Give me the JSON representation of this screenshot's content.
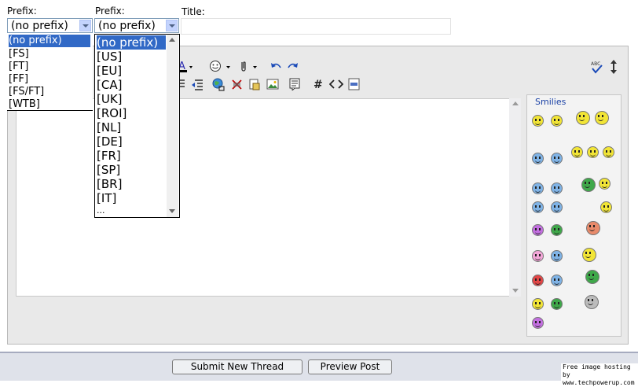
{
  "form": {
    "prefix1_label": "Prefix:",
    "prefix2_label": "Prefix:",
    "title_label": "Title:",
    "prefix1_value": "(no prefix)",
    "prefix2_value": "(no prefix)"
  },
  "dropdown1": {
    "options": [
      "(no prefix)",
      "[FS]",
      "[FT]",
      "[FF]",
      "[FS/FT]",
      "[WTB]"
    ]
  },
  "dropdown2": {
    "options": [
      "(no prefix)",
      "[US]",
      "[EU]",
      "[CA]",
      "[UK]",
      "[ROI]",
      "[NL]",
      "[DE]",
      "[FR]",
      "[SP]",
      "[BR]",
      "[IT]",
      "..."
    ]
  },
  "smilies": {
    "title": "Smilies"
  },
  "footer": {
    "submit_label": "Submit New Thread",
    "preview_label": "Preview Post"
  },
  "watermark": {
    "line1": "Free image hosting by",
    "line2": "www.techpowerup.com"
  },
  "colors": {
    "selection": "#3169c6",
    "smiley_yellow": "#f2e536",
    "smiley_blue": "#7fb3e6",
    "smiley_red": "#e24646",
    "smiley_green": "#3fa84a",
    "smiley_purple": "#c36fe0"
  },
  "icons": [
    "font-color-icon",
    "smiley-icon",
    "paperclip-icon",
    "undo-icon",
    "redo-icon",
    "spellcheck-icon",
    "resize-icon",
    "align-right-icon",
    "outdent-icon",
    "link-icon",
    "unlink-icon",
    "insert-image-icon",
    "image-icon",
    "quote-icon",
    "hash-icon",
    "code-icon",
    "php-icon"
  ]
}
